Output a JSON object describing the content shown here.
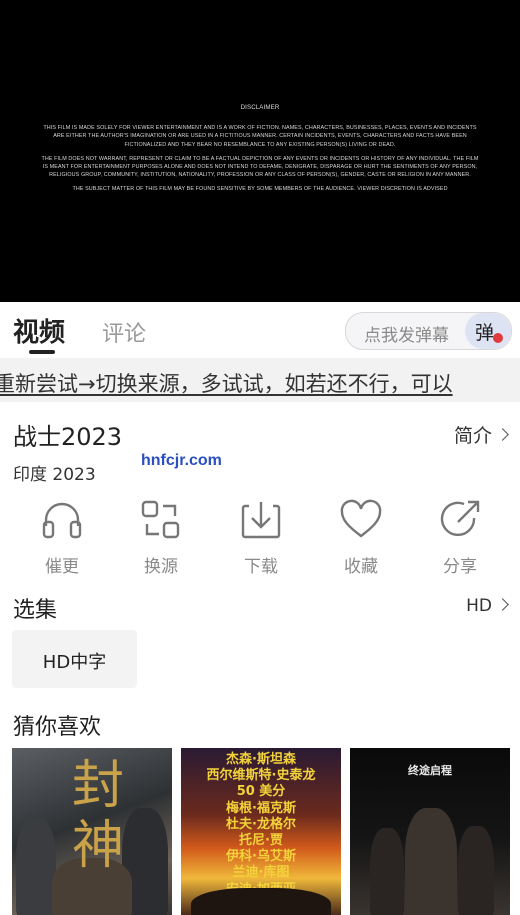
{
  "player": {
    "disclaimer_heading": "DISCLAIMER",
    "paragraphs": [
      "THIS FILM IS MADE SOLELY FOR VIEWER ENTERTAINMENT AND IS A WORK OF FICTION. NAMES, CHARACTERS, BUSINESSES, PLACES, EVENTS AND INCIDENTS ARE EITHER THE AUTHOR'S IMAGINATION OR ARE USED IN A FICTITIOUS MANNER. CERTAIN INCIDENTS, EVENTS, CHARACTERS AND FACTS HAVE BEEN FICTIONALIZED AND THEY BEAR NO RESEMBLANCE TO ANY EXISTING PERSON(S) LIVING OR DEAD.",
      "THE FILM DOES NOT WARRANT, REPRESENT OR CLAIM TO BE A FACTUAL DEPICTION OF ANY EVENTS OR INCIDENTS OR HISTORY OF ANY INDIVIDUAL. THE FILM IS MEANT FOR ENTERTAINMENT PURPOSES ALONE AND DOES NOT INTEND TO DEFAME, DENIGRATE, DISPARAGE OR HURT THE SENTIMENTS OF ANY PERSON, RELIGIOUS GROUP, COMMUNITY, INSTITUTION, NATIONALITY, PROFESSION OR ANY CLASS OF PERSON(S), GENDER, CASTE OR RELIGION IN ANY MANNER.",
      "THE SUBJECT MATTER OF THIS FILM MAY BE FOUND SENSITIVE BY SOME MEMBERS OF THE AUDIENCE. VIEWER DISCRETION IS ADVISED"
    ]
  },
  "tabs": {
    "video": "视频",
    "comment": "评论"
  },
  "danmu": {
    "placeholder": "点我发弹幕",
    "button": "弹"
  },
  "notice": "重新尝试→切换来源，多试试，如若还不行，可以",
  "info": {
    "title": "战士2023",
    "intro_label": "简介",
    "meta": "印度  2023",
    "watermark": "hnfcjr.com"
  },
  "actions": [
    {
      "label": "催更",
      "icon": "headphones-icon"
    },
    {
      "label": "换源",
      "icon": "switch-source-icon"
    },
    {
      "label": "下载",
      "icon": "download-icon"
    },
    {
      "label": "收藏",
      "icon": "heart-icon"
    },
    {
      "label": "分享",
      "icon": "share-icon"
    }
  ],
  "episodes": {
    "title": "选集",
    "quality": "HD",
    "items": [
      "HD中字"
    ]
  },
  "recommend": {
    "title": "猜你喜欢",
    "posters": [
      {
        "text": "封神"
      },
      {
        "text": "杰森·斯坦森\n西尔维斯特·史泰龙\n50 美分\n梅根·福克斯\n杜夫·龙格尔\n托尼·贾\n伊科·乌艾斯\n兰迪·库图\n安迪·加西亚"
      },
      {
        "text": "终途启程"
      }
    ]
  },
  "colors": {
    "accent": "#222222",
    "danmu_button": "#dde3f3",
    "watermark": "#2a4fc0"
  }
}
